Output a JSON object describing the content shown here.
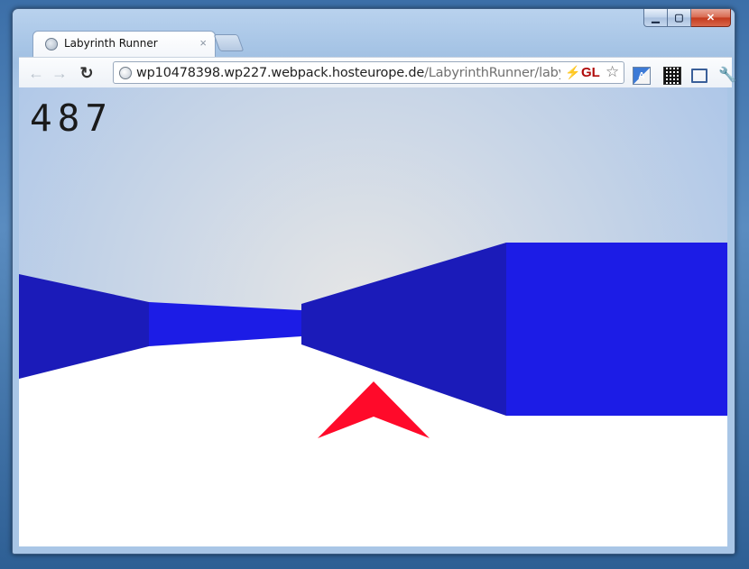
{
  "browser": {
    "tab_title": "Labyrinth Runner",
    "tab_close_glyph": "×",
    "url_host": "wp10478398.wp227.webpack.hosteurope.de",
    "url_path": "/LabyrinthRunner/labyrinthl",
    "omnibox_badge": "GL",
    "icons": {
      "back": "arrow-left-icon",
      "forward": "arrow-right-icon",
      "reload": "reload-icon",
      "bookmark": "star-icon",
      "translate": "translate-icon",
      "qr": "qr-code-icon",
      "fullscreen": "fullscreen-icon",
      "settings": "wrench-icon"
    }
  },
  "game": {
    "score": "487",
    "colors": {
      "sky_center": "#e6e6e6",
      "sky_edge": "#a9c4e8",
      "floor": "#ffffff",
      "wall_side": "#1b1bb9",
      "wall_front": "#1c1ce6",
      "arrow": "#ff0a2a"
    }
  }
}
